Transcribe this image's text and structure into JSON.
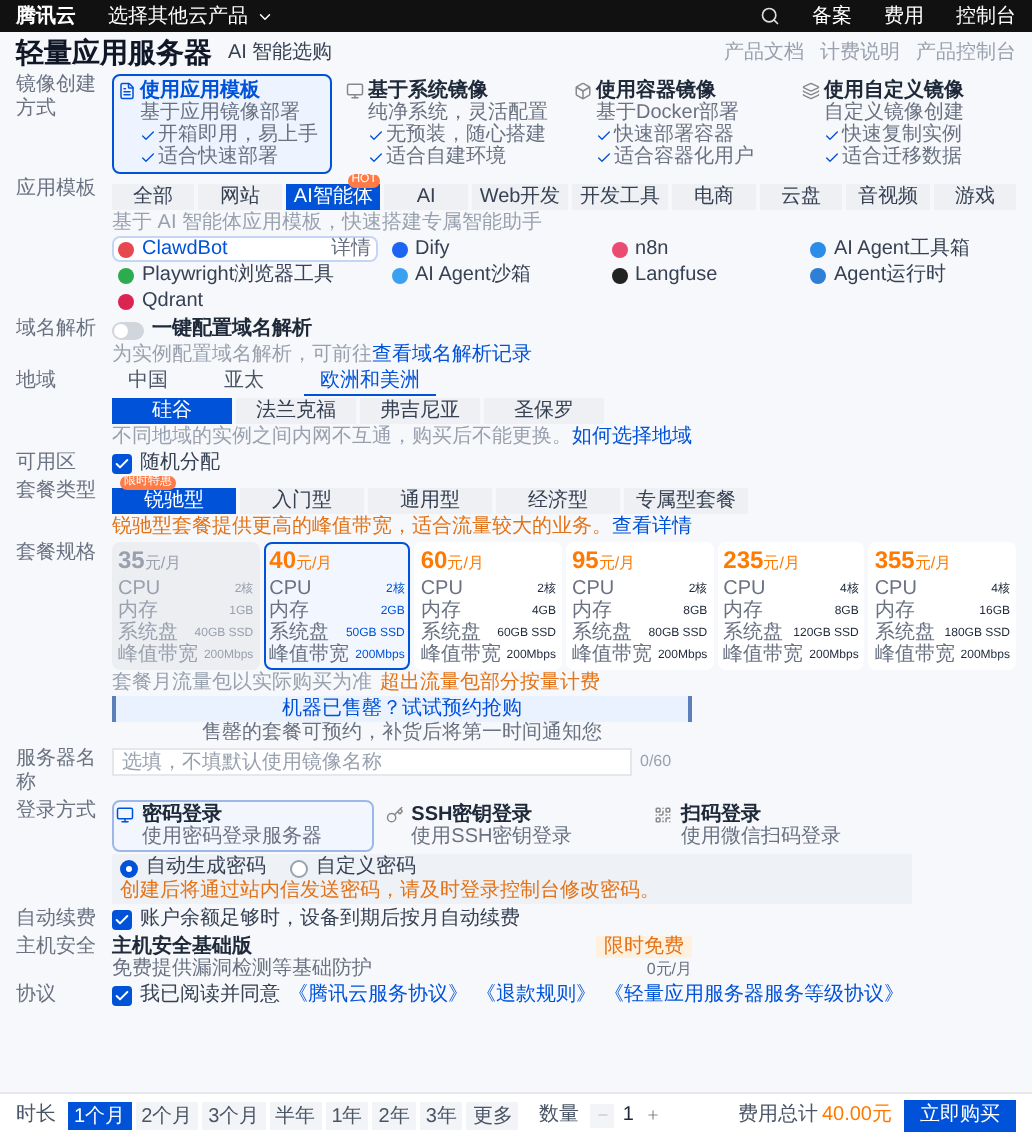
{
  "top_bar": {
    "logo": "腾讯云",
    "product_menu": "选择其他云产品",
    "links": [
      "备案",
      "费用",
      "控制台"
    ]
  },
  "header": {
    "title": "轻量应用服务器",
    "ai_button": "AI 智能选购",
    "links": [
      "产品文档",
      "计费说明",
      "产品控制台"
    ]
  },
  "image_method": {
    "label": "镜像创建方式",
    "options": [
      {
        "title": "使用应用模板",
        "desc": "基于应用镜像部署",
        "points": [
          "开箱即用，易上手",
          "适合快速部署"
        ],
        "selected": true
      },
      {
        "title": "基于系统镜像",
        "desc": "纯净系统，灵活配置",
        "points": [
          "无预装，随心搭建",
          "适合自建环境"
        ],
        "selected": false
      },
      {
        "title": "使用容器镜像",
        "desc": "基于Docker部署",
        "points": [
          "快速部署容器",
          "适合容器化用户"
        ],
        "selected": false
      },
      {
        "title": "使用自定义镜像",
        "desc": "自定义镜像创建",
        "points": [
          "快速复制实例",
          "适合迁移数据"
        ],
        "selected": false
      }
    ]
  },
  "app_template": {
    "label": "应用模板",
    "categories": [
      {
        "label": "全部",
        "selected": false
      },
      {
        "label": "网站",
        "selected": false
      },
      {
        "label": "AI智能体",
        "selected": true,
        "badge": "HOT"
      },
      {
        "label": "AI",
        "selected": false
      },
      {
        "label": "Web开发",
        "selected": false
      },
      {
        "label": "开发工具",
        "selected": false
      },
      {
        "label": "电商",
        "selected": false
      },
      {
        "label": "云盘",
        "selected": false
      },
      {
        "label": "音视频",
        "selected": false
      },
      {
        "label": "游戏",
        "selected": false
      }
    ],
    "hint": "基于 AI 智能体应用模板，快速搭建专属智能助手",
    "apps": [
      {
        "name": "ClawdBot",
        "detail": "详情",
        "selected": true,
        "color": "#e5484d"
      },
      {
        "name": "Dify",
        "selected": false,
        "color": "#1c64f2"
      },
      {
        "name": "n8n",
        "selected": false,
        "color": "#ea4b71"
      },
      {
        "name": "AI Agent工具箱",
        "selected": false,
        "color": "#2b8de8"
      },
      {
        "name": "Playwright浏览器工具",
        "selected": false,
        "color": "#2eaa4f"
      },
      {
        "name": "AI Agent沙箱",
        "selected": false,
        "color": "#3aa0f0"
      },
      {
        "name": "Langfuse",
        "selected": false,
        "color": "#222222"
      },
      {
        "name": "Agent运行时",
        "selected": false,
        "color": "#2f7fd8"
      },
      {
        "name": "Qdrant",
        "selected": false,
        "color": "#dc2454"
      }
    ]
  },
  "domain": {
    "label": "域名解析",
    "toggle": "一键配置域名解析",
    "on": false,
    "hint": "为实例配置域名解析，可前往",
    "link": "查看域名解析记录"
  },
  "region": {
    "label": "地域",
    "areas": [
      {
        "label": "中国",
        "selected": false
      },
      {
        "label": "亚太",
        "selected": false
      },
      {
        "label": "欧洲和美洲",
        "selected": true
      }
    ],
    "cities": [
      {
        "label": "硅谷",
        "selected": true
      },
      {
        "label": "法兰克福",
        "selected": false
      },
      {
        "label": "弗吉尼亚",
        "selected": false
      },
      {
        "label": "圣保罗",
        "selected": false
      }
    ],
    "hint": "不同地域的实例之间内网不互通，购买后不能更换。",
    "link": "如何选择地域"
  },
  "zone": {
    "label": "可用区",
    "checkbox": "随机分配",
    "checked": true
  },
  "plan_type": {
    "label": "套餐类型",
    "types": [
      {
        "label": "锐驰型",
        "selected": true,
        "badge": "限时特惠"
      },
      {
        "label": "入门型",
        "selected": false
      },
      {
        "label": "通用型",
        "selected": false
      },
      {
        "label": "经济型",
        "selected": false
      },
      {
        "label": "专属型套餐",
        "selected": false
      }
    ],
    "hint": "锐驰型套餐提供更高的峰值带宽，适合流量较大的业务。",
    "link": "查看详情"
  },
  "plan_spec": {
    "label": "套餐规格",
    "plans": [
      {
        "price": "35",
        "unit": "元/月",
        "disabled": true,
        "selected": false,
        "specs": [
          {
            "name": "CPU",
            "value": "2核"
          },
          {
            "name": "内存",
            "value": "1GB"
          },
          {
            "name": "系统盘",
            "value": "40GB SSD"
          },
          {
            "name": "峰值带宽",
            "value": "200Mbps"
          }
        ]
      },
      {
        "price": "40",
        "unit": "元/月",
        "disabled": false,
        "selected": true,
        "specs": [
          {
            "name": "CPU",
            "value": "2核"
          },
          {
            "name": "内存",
            "value": "2GB"
          },
          {
            "name": "系统盘",
            "value": "50GB SSD"
          },
          {
            "name": "峰值带宽",
            "value": "200Mbps"
          }
        ]
      },
      {
        "price": "60",
        "unit": "元/月",
        "disabled": false,
        "selected": false,
        "specs": [
          {
            "name": "CPU",
            "value": "2核"
          },
          {
            "name": "内存",
            "value": "4GB"
          },
          {
            "name": "系统盘",
            "value": "60GB SSD"
          },
          {
            "name": "峰值带宽",
            "value": "200Mbps"
          }
        ]
      },
      {
        "price": "95",
        "unit": "元/月",
        "disabled": false,
        "selected": false,
        "specs": [
          {
            "name": "CPU",
            "value": "2核"
          },
          {
            "name": "内存",
            "value": "8GB"
          },
          {
            "name": "系统盘",
            "value": "80GB SSD"
          },
          {
            "name": "峰值带宽",
            "value": "200Mbps"
          }
        ]
      },
      {
        "price": "235",
        "unit": "元/月",
        "disabled": false,
        "selected": false,
        "specs": [
          {
            "name": "CPU",
            "value": "4核"
          },
          {
            "name": "内存",
            "value": "8GB"
          },
          {
            "name": "系统盘",
            "value": "120GB SSD"
          },
          {
            "name": "峰值带宽",
            "value": "200Mbps"
          }
        ]
      },
      {
        "price": "355",
        "unit": "元/月",
        "disabled": false,
        "selected": false,
        "specs": [
          {
            "name": "CPU",
            "value": "4核"
          },
          {
            "name": "内存",
            "value": "16GB"
          },
          {
            "name": "系统盘",
            "value": "180GB SSD"
          },
          {
            "name": "峰值带宽",
            "value": "200Mbps"
          }
        ]
      }
    ],
    "note": "套餐月流量包以实际购买为准",
    "note_warning": "超出流量包部分按量计费",
    "banner": "机器已售罄？试试预约抢购",
    "banner_hint": "售罄的套餐可预约，补货后将第一时间通知您"
  },
  "name": {
    "label": "服务器名称",
    "placeholder": "选填，不填默认使用镜像名称",
    "counter": "0/60"
  },
  "login": {
    "label": "登录方式",
    "methods": [
      {
        "title": "密码登录",
        "desc": "使用密码登录服务器",
        "selected": true,
        "kind": "password"
      },
      {
        "title": "SSH密钥登录",
        "desc": "使用SSH密钥登录",
        "selected": false,
        "kind": "key"
      },
      {
        "title": "扫码登录",
        "desc": "使用微信扫码登录",
        "selected": false,
        "kind": "qr"
      }
    ],
    "password_options": [
      {
        "label": "自动生成密码",
        "selected": true
      },
      {
        "label": "自定义密码",
        "selected": false
      }
    ],
    "warning": "创建后将通过站内信发送密码，请及时登录控制台修改密码。"
  },
  "auto_renew": {
    "label": "自动续费",
    "checkbox": "账户余额足够时，设备到期后按月自动续费",
    "checked": true
  },
  "security": {
    "label": "主机安全",
    "title": "主机安全基础版",
    "desc": "免费提供漏洞检测等基础防护",
    "tag": "限时免费",
    "sub": "0元/月"
  },
  "agreement": {
    "label": "协议",
    "checkbox": "我已阅读并同意",
    "links": [
      "《腾讯云服务协议》",
      "《退款规则》",
      "《轻量应用服务器服务等级协议》"
    ],
    "checked": true
  },
  "footer": {
    "duration_label": "时长",
    "durations": [
      {
        "label": "1个月",
        "selected": true
      },
      {
        "label": "2个月",
        "selected": false
      },
      {
        "label": "3个月",
        "selected": false
      },
      {
        "label": "半年",
        "selected": false
      },
      {
        "label": "1年",
        "selected": false
      },
      {
        "label": "2年",
        "selected": false
      },
      {
        "label": "3年",
        "selected": false
      },
      {
        "label": "更多",
        "selected": false
      }
    ],
    "quantity_label": "数量",
    "quantity": "1",
    "total_label": "费用总计",
    "total": "40.00元",
    "buy": "立即购买"
  }
}
